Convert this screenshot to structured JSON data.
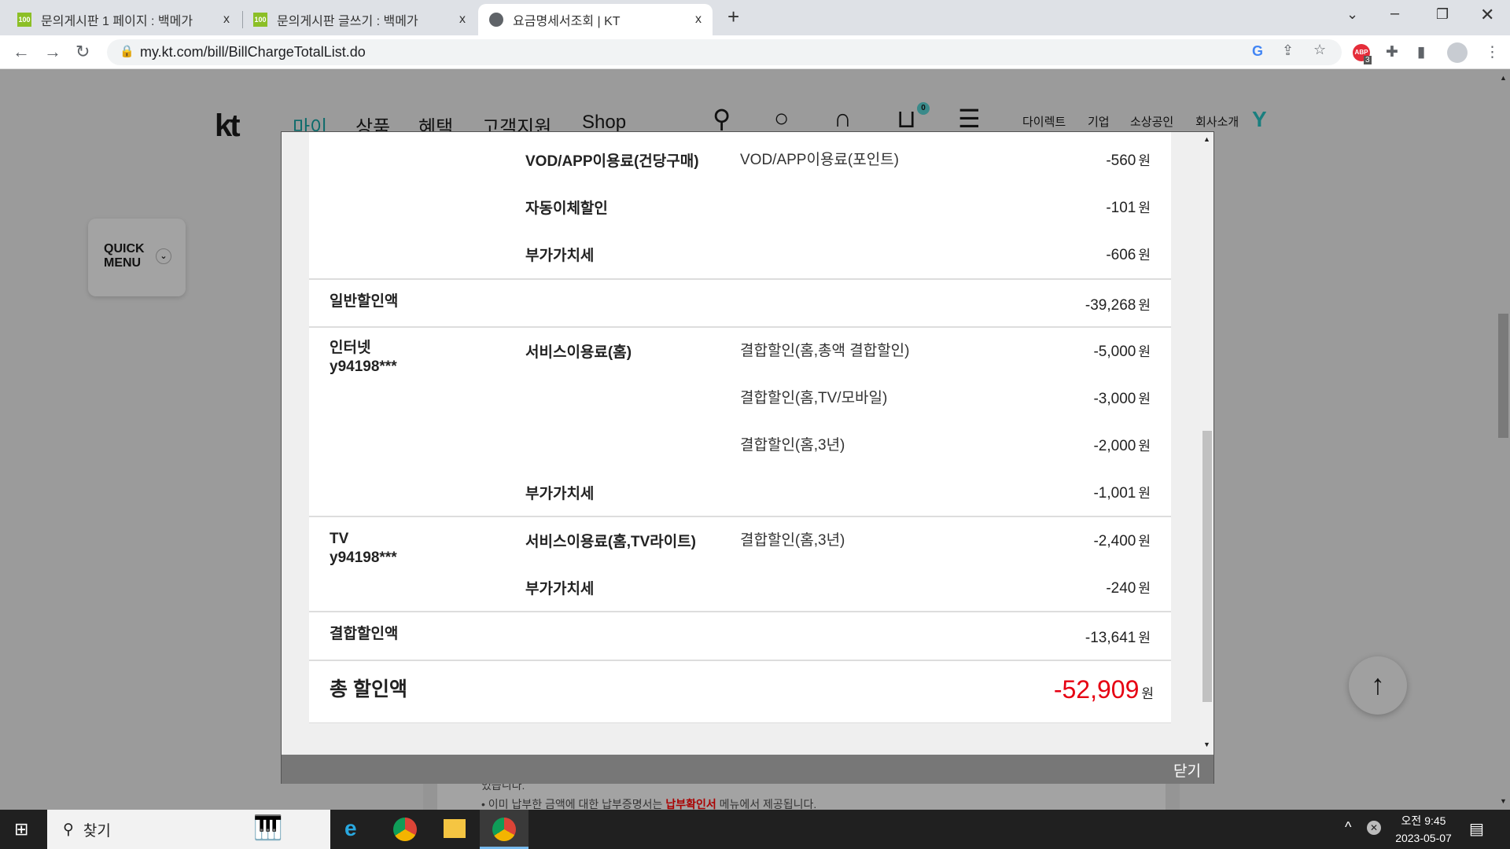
{
  "browser": {
    "tabs": [
      {
        "title": "문의게시판 1 페이지 : 백메가",
        "favicon": "100"
      },
      {
        "title": "문의게시판 글쓰기 : 백메가",
        "favicon": "100"
      },
      {
        "title": "요금명세서조회 | KT"
      }
    ],
    "close_glyph": "x",
    "new_tab": "+",
    "url": "my.kt.com/bill/BillChargeTotalList.do",
    "abp_badge": "3"
  },
  "header": {
    "logo": "kt",
    "nav": [
      "마이",
      "상품",
      "혜택",
      "고객지원",
      "Shop"
    ],
    "cart_count": "0",
    "links": [
      "다이렉트",
      "기업",
      "소상공인",
      "회사소개"
    ],
    "accent": "#0d8b8b"
  },
  "quick_menu": {
    "label_line1": "QUICK",
    "label_line2": "MENU"
  },
  "modal": {
    "rows": [
      {
        "c1": "",
        "c2": "VOD/APP이용료(건당구매)",
        "c3": "VOD/APP이용료(포인트)",
        "amount": "-560"
      },
      {
        "c1": "",
        "c2": "자동이체할인",
        "c3": "",
        "amount": "-101"
      },
      {
        "c1": "",
        "c2": "부가가치세",
        "c3": "",
        "amount": "-606"
      },
      {
        "c1": "일반할인액",
        "c2": "",
        "c3": "",
        "amount": "-39,268"
      },
      {
        "c1": "인터넷",
        "c1b": "y94198***",
        "c2": "서비스이용료(홈)",
        "c3": "결합할인(홈,총액 결합할인)",
        "amount": "-5,000"
      },
      {
        "c3": "결합할인(홈,TV/모바일)",
        "amount": "-3,000"
      },
      {
        "c3": "결합할인(홈,3년)",
        "amount": "-2,000"
      },
      {
        "c2": "부가가치세",
        "amount": "-1,001"
      },
      {
        "c1": "TV",
        "c1b": "y94198***",
        "c2": "서비스이용료(홈,TV라이트)",
        "c3": "결합할인(홈,3년)",
        "amount": "-2,400"
      },
      {
        "c2": "부가가치세",
        "amount": "-240"
      },
      {
        "c1": "결합할인액",
        "amount": "-13,641"
      }
    ],
    "currency": "원",
    "total_label": "총 할인액",
    "total_amount": "-52,909",
    "total_color": "#e60012",
    "close_label": "닫기"
  },
  "background_page": {
    "line1": "었습니다.",
    "line2_a": "이미 납부한 금액에 대한 납부증명서는 ",
    "line2_b": "납부확인서",
    "line2_c": " 메뉴에서 제공됩니다."
  },
  "taskbar": {
    "search_label": "찾기",
    "time": "오전 9:45",
    "date": "2023-05-07"
  }
}
